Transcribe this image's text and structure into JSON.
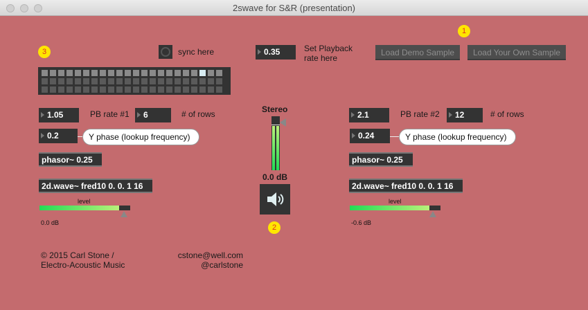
{
  "window": {
    "title": "2swave for S&R (presentation)"
  },
  "badges": [
    "1",
    "2",
    "3"
  ],
  "sync": {
    "label": "sync here"
  },
  "playback": {
    "value": "0.35",
    "label_line1": "Set Playback",
    "label_line2": "rate here"
  },
  "buttons": {
    "demo": "Load Demo Sample",
    "own": "Load Your Own Sample"
  },
  "grid": {
    "columns": 22,
    "rows": 3,
    "active_column": 19
  },
  "left": {
    "pb_rate": "1.05",
    "pb_label": "PB rate #1",
    "rows": "6",
    "rows_label": "# of rows",
    "yphase": "0.2",
    "yphase_label": "Y phase (lookup frequency)",
    "phasor": "phasor~ 0.25",
    "wave": "2d.wave~ fred10 0. 0. 1 16",
    "level_label": "level",
    "db": "0.0 dB",
    "level": 0.88
  },
  "right": {
    "pb_rate": "2.1",
    "pb_label": "PB rate #2",
    "rows": "12",
    "rows_label": "# of rows",
    "yphase": "0.24",
    "yphase_label": "Y phase (lookup frequency)",
    "phasor": "phasor~ 0.25",
    "wave": "2d.wave~ fred10 0. 0. 1 16",
    "level_label": "level",
    "db": "-0.6 dB",
    "level": 0.88
  },
  "master": {
    "label": "Stereo",
    "db": "0.0 dB",
    "level": 0.8
  },
  "credits": {
    "line1": "© 2015 Carl Stone /",
    "line2": "Electro-Acoustic Music",
    "email": "cstone@well.com",
    "handle": "@carlstone"
  }
}
